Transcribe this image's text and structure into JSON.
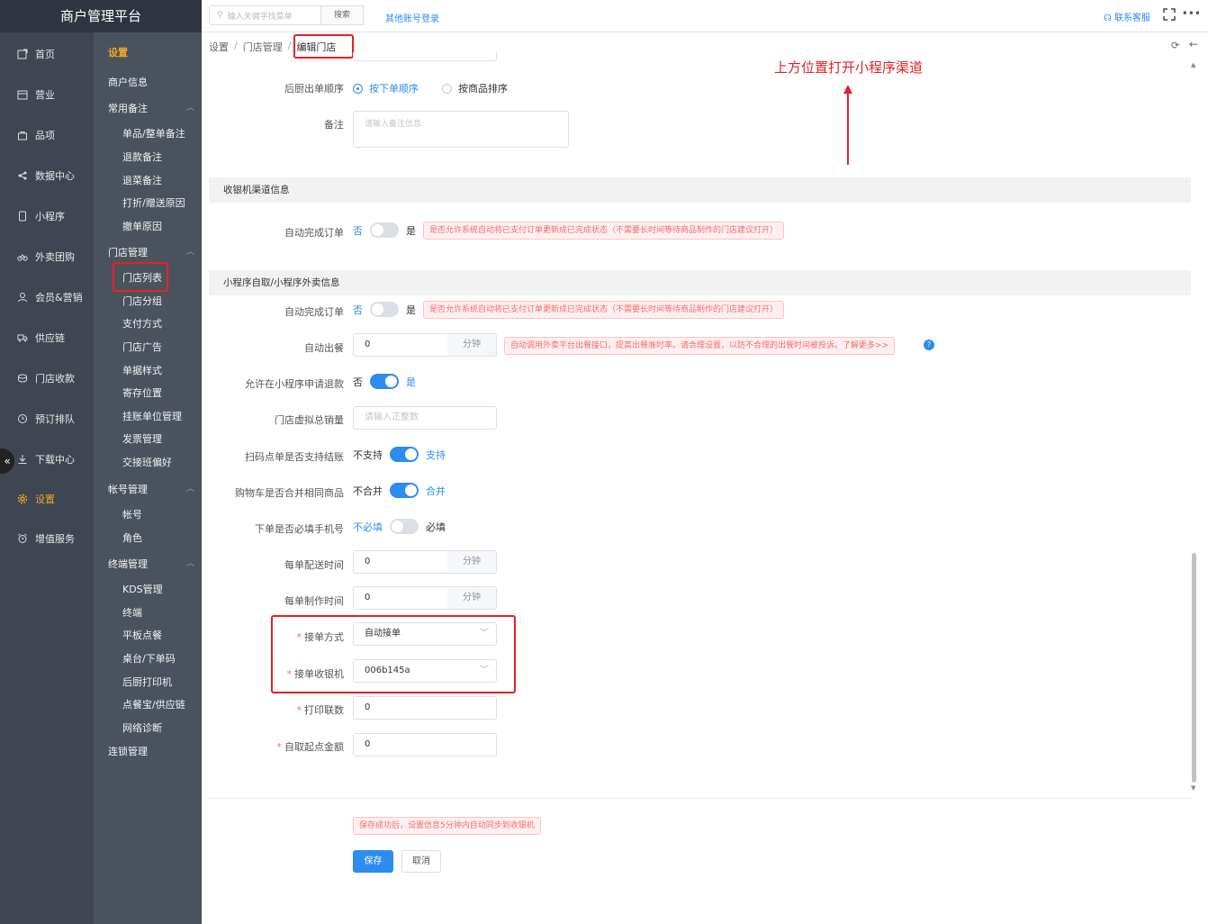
{
  "brand": "商户管理平台",
  "nav": [
    {
      "label": "首页",
      "icon": "external-link-icon"
    },
    {
      "label": "营业",
      "icon": "calendar-icon"
    },
    {
      "label": "品项",
      "icon": "bag-icon"
    },
    {
      "label": "数据中心",
      "icon": "share-icon"
    },
    {
      "label": "小程序",
      "icon": "phone-icon"
    },
    {
      "label": "外卖团购",
      "icon": "bike-icon"
    },
    {
      "label": "会员&营销",
      "icon": "user-icon"
    },
    {
      "label": "供应链",
      "icon": "truck-icon"
    },
    {
      "label": "门店收款",
      "icon": "coins-icon"
    },
    {
      "label": "预订排队",
      "icon": "clock-icon"
    },
    {
      "label": "下载中心",
      "icon": "download-icon"
    },
    {
      "label": "设置",
      "icon": "gear-icon"
    },
    {
      "label": "增值服务",
      "icon": "alarm-icon"
    }
  ],
  "subnav": {
    "title": "设置",
    "merchant_info": "商户信息",
    "group_remarks": "常用备注",
    "remarks": [
      "单品/整单备注",
      "退款备注",
      "退菜备注",
      "打折/赠送原因",
      "撤单原因"
    ],
    "group_store": "门店管理",
    "store": [
      "门店列表",
      "门店分组",
      "支付方式",
      "门店广告",
      "单据样式",
      "寄存位置",
      "挂账单位管理",
      "发票管理",
      "交接班偏好"
    ],
    "group_account": "帐号管理",
    "account": [
      "帐号",
      "角色"
    ],
    "group_terminal": "终端管理",
    "terminal": [
      "KDS管理",
      "终端",
      "平板点餐",
      "桌台/下单码",
      "后厨打印机",
      "点餐宝/供应链",
      "网络诊断"
    ],
    "chain": "连锁管理"
  },
  "topbar": {
    "search_placeholder": "输入关键字找菜单",
    "search_btn": "搜索",
    "other_login": "其他账号登录",
    "contact": "联系客服",
    "more": "•••"
  },
  "breadcrumb": [
    "设置",
    "门店管理",
    "编辑门店"
  ],
  "annotation": "上方位置打开小程序渠道",
  "form": {
    "kitchen_order_label": "后厨出单顺序",
    "kitchen_opt1": "按下单顺序",
    "kitchen_opt2": "按商品排序",
    "remark_label": "备注",
    "remark_placeholder": "请输入备注信息",
    "section_cashier": "收银机渠道信息",
    "auto_complete_label": "自动完成订单",
    "no": "否",
    "yes": "是",
    "auto_complete_tip": "是否允许系统自动将已支付订单更新成已完成状态（不需要长时间等待商品制作的门店建议打开）",
    "section_mini": "小程序自取/小程序外卖信息",
    "auto_out_label": "自动出餐",
    "auto_out_value": "0",
    "minute": "分钟",
    "auto_out_tip": "自动调用外卖平台出餐接口，提高出餐准时率。请合理设置，以防不合理的出餐时间被投诉。了解更多>>",
    "refund_label": "允许在小程序申请退款",
    "virtual_sales_label": "门店虚拟总销量",
    "virtual_sales_placeholder": "请输入正整数",
    "scan_label": "扫码点单是否支持结账",
    "not_support": "不支持",
    "support": "支持",
    "cart_label": "购物车是否合并相同商品",
    "not_merge": "不合并",
    "merge": "合并",
    "phone_label": "下单是否必填手机号",
    "not_required": "不必填",
    "required": "必填",
    "delivery_time_label": "每单配送时间",
    "delivery_time_value": "0",
    "make_time_label": "每单制作时间",
    "make_time_value": "0",
    "accept_mode_label": "接单方式",
    "accept_mode_value": "自动接单",
    "accept_cashier_label": "接单收银机",
    "accept_cashier_value": "006b145a",
    "print_copies_label": "打印联数",
    "print_copies_value": "0",
    "pickup_min_label": "自取起点金额",
    "pickup_min_value": "0"
  },
  "footer": {
    "tip": "保存成功后，设置信息5分钟内自动同步到收银机",
    "save": "保存",
    "cancel": "取消"
  },
  "colors": {
    "primary": "#2d8cf0",
    "danger": "#e62222",
    "nav_bg": "#3f4651",
    "subnav_bg": "#4a525e",
    "active": "#f5a623"
  }
}
